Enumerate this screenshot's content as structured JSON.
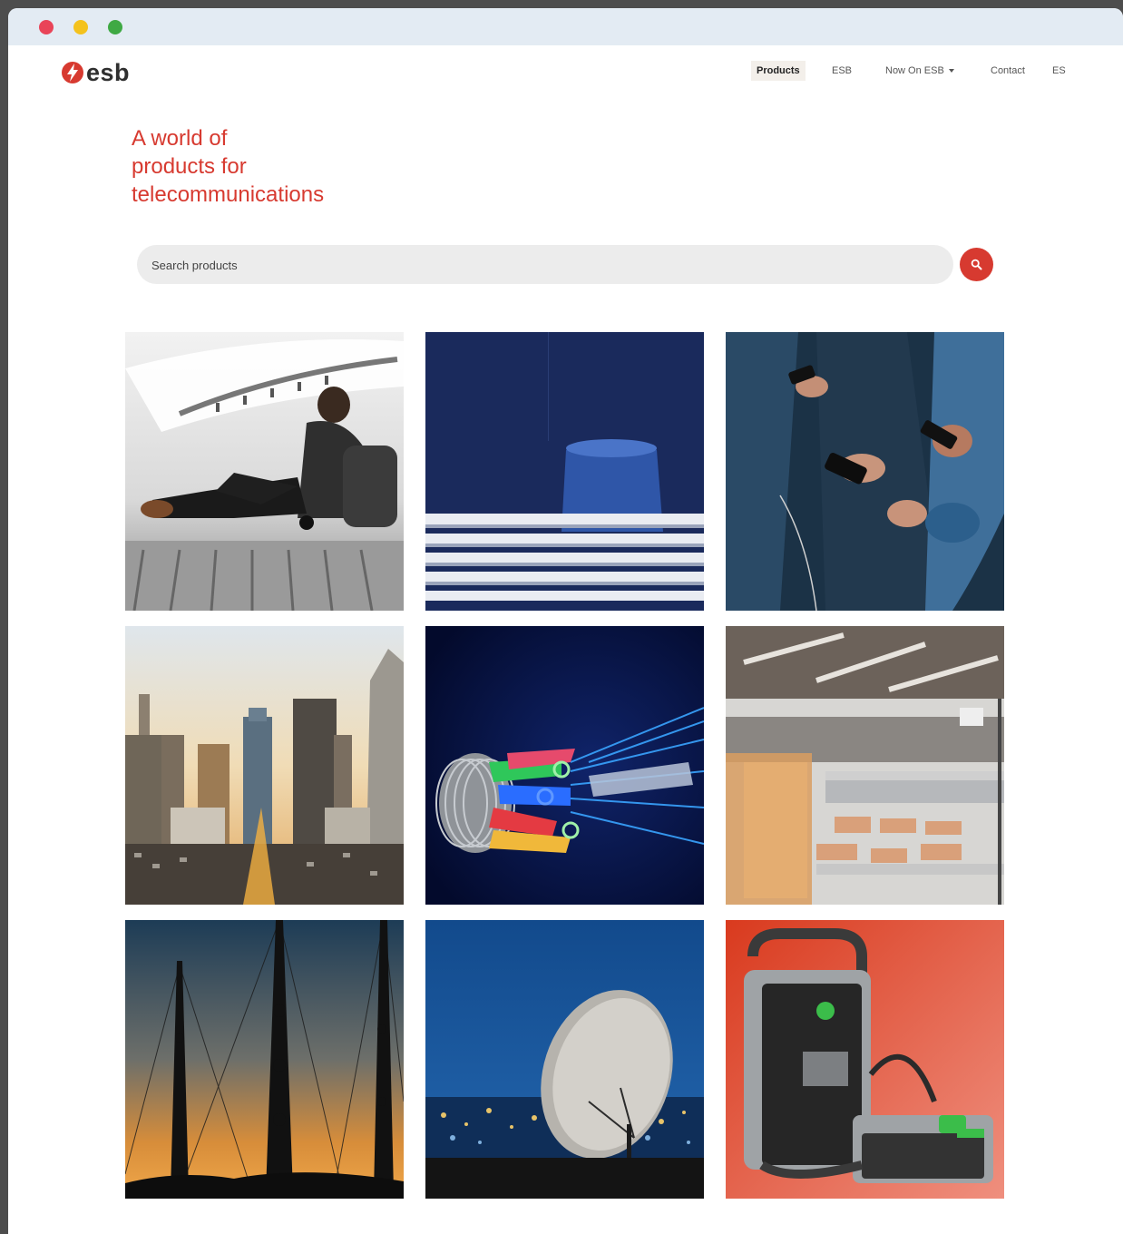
{
  "window": {
    "controls": [
      "close",
      "minimize",
      "maximize"
    ]
  },
  "header": {
    "logo_text": "esb",
    "logo_icon": "esb-lightning-logo",
    "brand_color": "#d73a30"
  },
  "nav": {
    "items": [
      {
        "label": "Products",
        "active": true
      },
      {
        "label": "ESB",
        "active": false
      },
      {
        "label": "Now On ESB",
        "active": false,
        "has_dropdown": true
      },
      {
        "label": "Contact",
        "active": false
      },
      {
        "label": "ES",
        "active": false
      }
    ]
  },
  "hero": {
    "title": "A world of\nproducts for\ntelecommunications"
  },
  "search": {
    "placeholder": "Search products",
    "value": "",
    "button_icon": "search-icon"
  },
  "gallery": {
    "tiles": [
      {
        "subject": "man-sitting-with-phone"
      },
      {
        "subject": "blue-architecture"
      },
      {
        "subject": "people-using-smartphones"
      },
      {
        "subject": "city-skyline"
      },
      {
        "subject": "fiber-optic-cable"
      },
      {
        "subject": "warehouse-shelves"
      },
      {
        "subject": "telecom-towers-sunset"
      },
      {
        "subject": "satellite-dish-night"
      },
      {
        "subject": "portable-power-station"
      }
    ]
  }
}
